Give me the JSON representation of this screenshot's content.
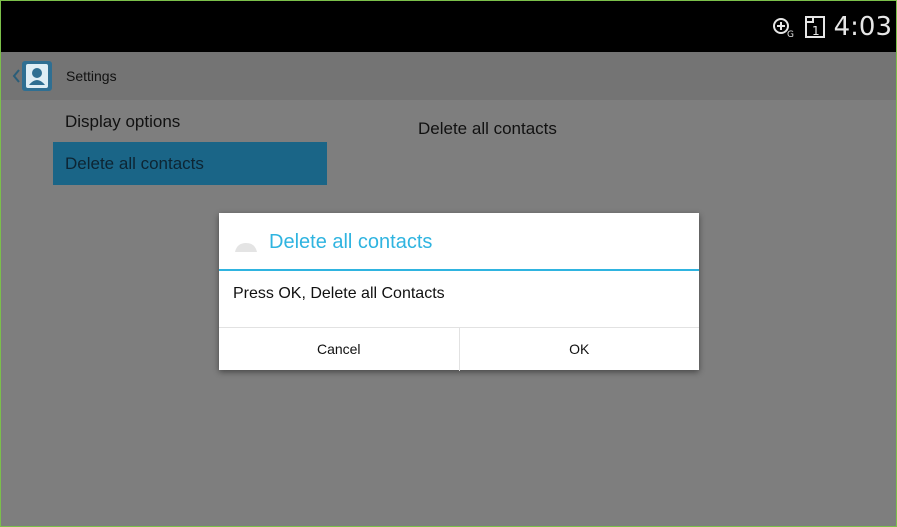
{
  "status_bar": {
    "time": "4:03",
    "icons": [
      "sync-icon",
      "sim-1-icon"
    ]
  },
  "app_bar": {
    "title": "Settings",
    "icons": [
      "back-chevron-icon",
      "contacts-app-icon"
    ]
  },
  "sidebar": {
    "items": [
      {
        "label": "Display options",
        "selected": false
      },
      {
        "label": "Delete all contacts",
        "selected": true
      }
    ]
  },
  "detail": {
    "title": "Delete all contacts"
  },
  "dialog": {
    "title": "Delete all contacts",
    "message": "Press OK, Delete all Contacts",
    "cancel_label": "Cancel",
    "ok_label": "OK",
    "accent_color": "#2fb4e0"
  },
  "colors": {
    "status_bar": "#000000",
    "app_bar": "#747474",
    "dim_background": "#7e7e7e",
    "selected_item": "#1a6587",
    "dialog_accent": "#2fb4e0"
  }
}
